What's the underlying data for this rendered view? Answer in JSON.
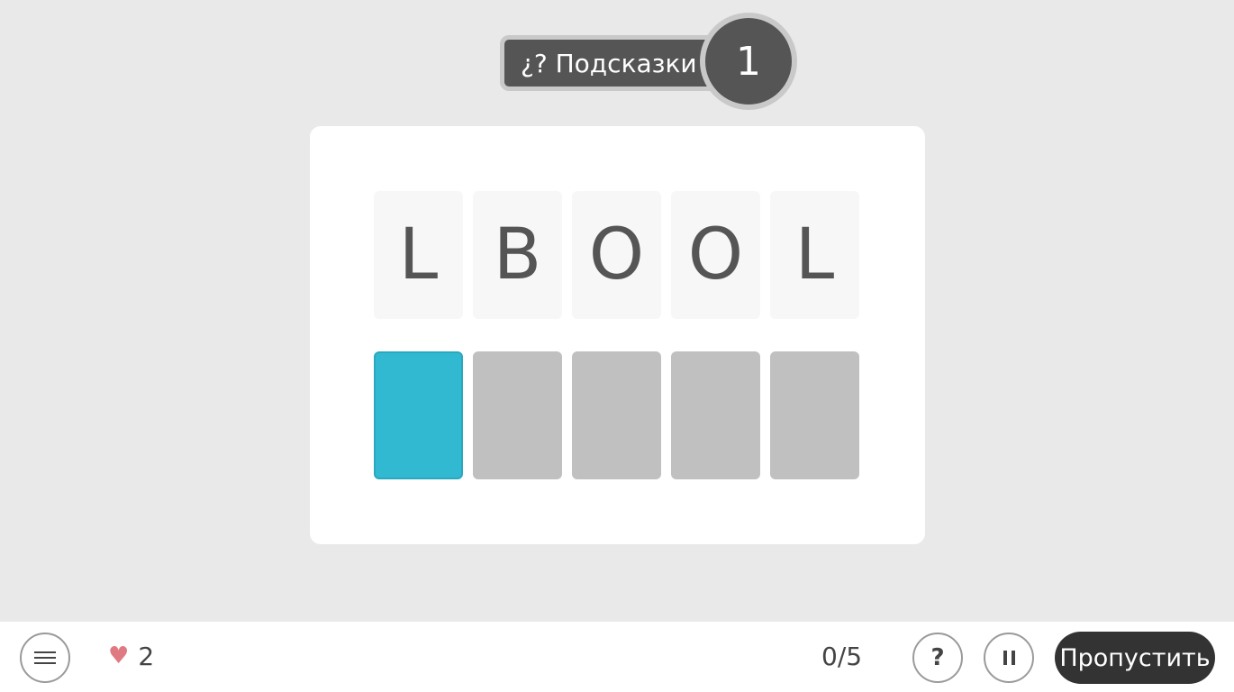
{
  "hints": {
    "label": "¿? Подсказки",
    "count": "1"
  },
  "letters": [
    "L",
    "B",
    "O",
    "O",
    "L"
  ],
  "slots": [
    {
      "state": "active",
      "color": "#31b9d1"
    },
    {
      "state": "empty",
      "color": "#c0c0c0"
    },
    {
      "state": "empty",
      "color": "#c0c0c0"
    },
    {
      "state": "empty",
      "color": "#c0c0c0"
    },
    {
      "state": "empty",
      "color": "#c0c0c0"
    }
  ],
  "footer": {
    "menu_icon": "hamburger-icon",
    "lives_icon": "heart-icon",
    "lives": "2",
    "progress": "0/5",
    "help_label": "?",
    "pause_icon": "pause-icon",
    "skip_label": "Пропустить"
  },
  "colors": {
    "accent": "#31b9d1",
    "heart": "#e07a82",
    "dark_button": "#333333",
    "hint_pill": "#555555"
  }
}
